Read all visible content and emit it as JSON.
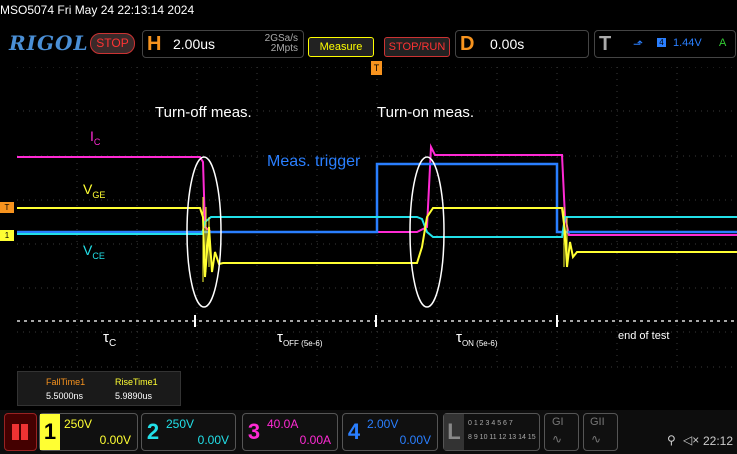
{
  "title": "MSO5074  Fri May 24 22:13:14 2024",
  "logo": "RIGOL",
  "run_state": "STOP",
  "horizontal": {
    "letter": "H",
    "scale": "2.00us",
    "sample_rate": "2GSa/s",
    "points": "2Mpts"
  },
  "measure_button": "Measure",
  "stoprun_button": "STOP/RUN",
  "delay": {
    "letter": "D",
    "value": "0.00s"
  },
  "trigger": {
    "letter": "T",
    "level": "1.44V",
    "source": "A"
  },
  "annotations": {
    "turnoff": "Turn-off meas.",
    "turnon": "Turn-on meas.",
    "meas_trigger": "Meas. trigger",
    "ic": "I",
    "ic_sub": "C",
    "vge": "V",
    "vge_sub": "GE",
    "vce": "V",
    "vce_sub": "CE"
  },
  "segments": {
    "tc": "τ",
    "tc_sub": "C",
    "toff": "τ",
    "toff_sub": "OFF (5e-6)",
    "ton": "τ",
    "ton_sub": "ON (5e-6)",
    "end": "end of test"
  },
  "measurements": [
    {
      "name": "FallTime1",
      "value": "5.5000ns"
    },
    {
      "name": "RiseTime1",
      "value": "5.9890us"
    }
  ],
  "channels": [
    {
      "num": "1",
      "scale": "250V",
      "offset": "0.00V",
      "color": "#ffff33"
    },
    {
      "num": "2",
      "scale": "250V",
      "offset": "0.00V",
      "color": "#22e0e8"
    },
    {
      "num": "3",
      "scale": "40.0A",
      "offset": "0.00A",
      "color": "#ff2ad4"
    },
    {
      "num": "4",
      "scale": "2.00V",
      "offset": "0.00V",
      "color": "#2a7fff"
    }
  ],
  "la": {
    "letter": "L",
    "row1": "0 1 2 3  4 5 6 7",
    "row2": "8 9 10 11 12 13 14 15"
  },
  "g1": "GI",
  "g2": "GII",
  "clock": "22:12",
  "colors": {
    "ch1": "#ffff33",
    "ch2": "#22e0e8",
    "ch3": "#ff2ad4",
    "ch4": "#2a7fff",
    "accent": "#f7931e",
    "stop": "#ff3333"
  }
}
